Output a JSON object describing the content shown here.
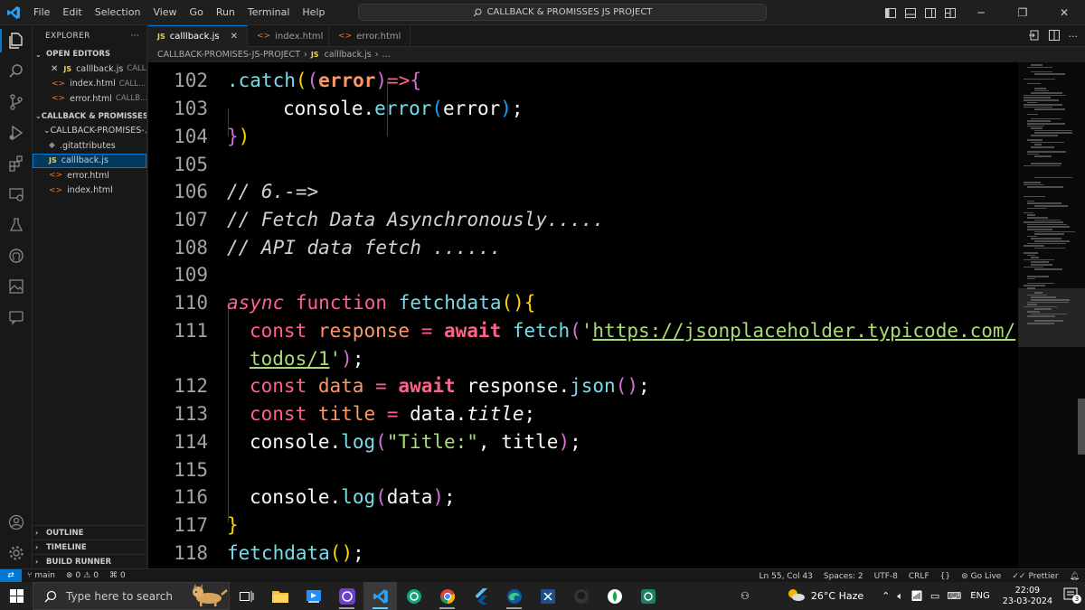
{
  "menu": [
    "File",
    "Edit",
    "Selection",
    "View",
    "Go",
    "Run",
    "Terminal",
    "Help"
  ],
  "command_center": "CALLBACK & PROMISSES JS PROJECT",
  "explorer": {
    "title": "EXPLORER",
    "open_editors_label": "OPEN EDITORS",
    "open_editors": [
      {
        "name": "calllback.js",
        "desc": "CALL...",
        "type": "js"
      },
      {
        "name": "index.html",
        "desc": "CALL...",
        "type": "html"
      },
      {
        "name": "error.html",
        "desc": "CALLB...",
        "type": "html"
      }
    ],
    "workspace_label": "CALLBACK & PROMISSES J...",
    "folder_label": "CALLBACK-PROMISES-...",
    "files": [
      {
        "name": ".gitattributes",
        "type": "git"
      },
      {
        "name": "calllback.js",
        "type": "js"
      },
      {
        "name": "error.html",
        "type": "html"
      },
      {
        "name": "index.html",
        "type": "html"
      }
    ],
    "bottom_sections": [
      "OUTLINE",
      "TIMELINE",
      "BUILD RUNNER"
    ]
  },
  "tabs": [
    {
      "label": "calllback.js",
      "type": "js",
      "active": true
    },
    {
      "label": "index.html",
      "type": "html",
      "active": false
    },
    {
      "label": "error.html",
      "type": "html",
      "active": false
    }
  ],
  "breadcrumb": {
    "folder": "CALLBACK-PROMISES-JS-PROJECT",
    "file": "calllback.js",
    "tail": "..."
  },
  "editor": {
    "lines": [
      {
        "n": "102"
      },
      {
        "n": "103"
      },
      {
        "n": "104"
      },
      {
        "n": "105"
      },
      {
        "n": "106"
      },
      {
        "n": "107"
      },
      {
        "n": "108"
      },
      {
        "n": "109"
      },
      {
        "n": "110"
      },
      {
        "n": "111"
      },
      {
        "n": ""
      },
      {
        "n": "112"
      },
      {
        "n": "113"
      },
      {
        "n": "114"
      },
      {
        "n": "115"
      },
      {
        "n": "116"
      },
      {
        "n": "117"
      },
      {
        "n": "118"
      }
    ],
    "code": {
      "l102_a": ".catch",
      "l102_b": "error",
      "l103_a": "console",
      "l103_b": "error",
      "l103_c": "error",
      "l106": "// 6.-=>",
      "l107": "// Fetch Data Asynchronously.....",
      "l108": "// API data fetch ......",
      "l110_async": "async",
      "l110_function": "function",
      "l110_name": "fetchdata",
      "l111_const": "const",
      "l111_var": "response",
      "l111_await": "await",
      "l111_fn": "fetch",
      "l111_url1": "https://jsonplaceholder.typicode.com/",
      "l111_url2": "todos/1",
      "l112_const": "const",
      "l112_var": "data",
      "l112_await": "await",
      "l112_obj": "response",
      "l112_fn": "json",
      "l113_const": "const",
      "l113_var": "title",
      "l113_obj": "data",
      "l113_prop": "title",
      "l114_obj": "console",
      "l114_fn": "log",
      "l114_str": "\"Title:\"",
      "l114_arg": "title",
      "l116_obj": "console",
      "l116_fn": "log",
      "l116_arg": "data",
      "l118_fn": "fetchdata"
    }
  },
  "statusbar": {
    "branch": "main",
    "errors": "0",
    "warnings": "0",
    "ports": "0",
    "position": "Ln 55, Col 43",
    "spaces": "Spaces: 2",
    "encoding": "UTF-8",
    "eol": "CRLF",
    "golive": "Go Live",
    "prettier": "Prettier"
  },
  "taskbar": {
    "search_placeholder": "Type here to search",
    "weather": "26°C  Haze",
    "lang": "ENG",
    "time": "22:09",
    "date": "23-03-2024",
    "notif_count": "3"
  },
  "colors": {
    "accent": "#0078d4",
    "keyword": "#ff6188",
    "function": "#78dce8",
    "string": "#a9dc76",
    "bracket_gold": "#ffd700",
    "bracket_purple": "#da70d6",
    "bracket_blue": "#179fff"
  }
}
